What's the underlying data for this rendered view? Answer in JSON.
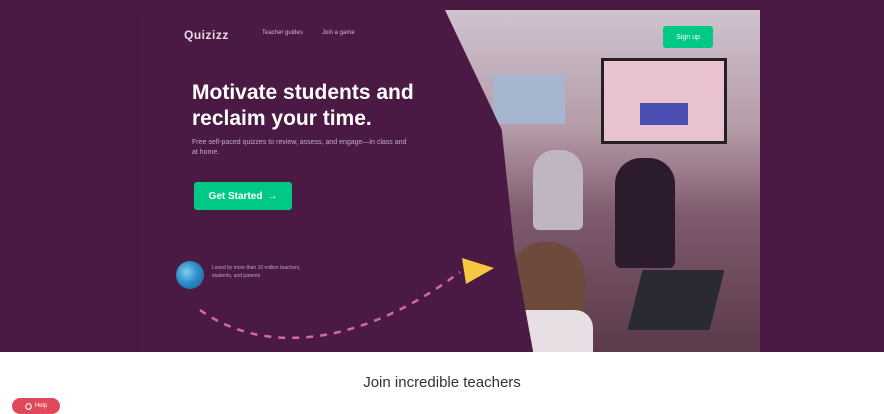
{
  "header": {
    "logo": "Quizizz",
    "nav": [
      "Teacher guides",
      "Join a game"
    ],
    "signup_label": "Sign up"
  },
  "hero": {
    "headline": "Motivate students and reclaim your time.",
    "subtext": "Free self-paced quizzes to review, assess, and engage—in class and at home.",
    "cta_label": "Get Started",
    "cta_arrow": "→",
    "trusted_text": "Loved by more than 10 million teachers, students, and parents"
  },
  "section": {
    "title": "Join incredible teachers"
  },
  "help": {
    "label": "Help",
    "icon": "chat-icon"
  },
  "colors": {
    "purple": "#4b1a44",
    "green": "#00c985",
    "path": "#d26a9c",
    "plane": "#f5c842",
    "help": "#e0485b"
  }
}
